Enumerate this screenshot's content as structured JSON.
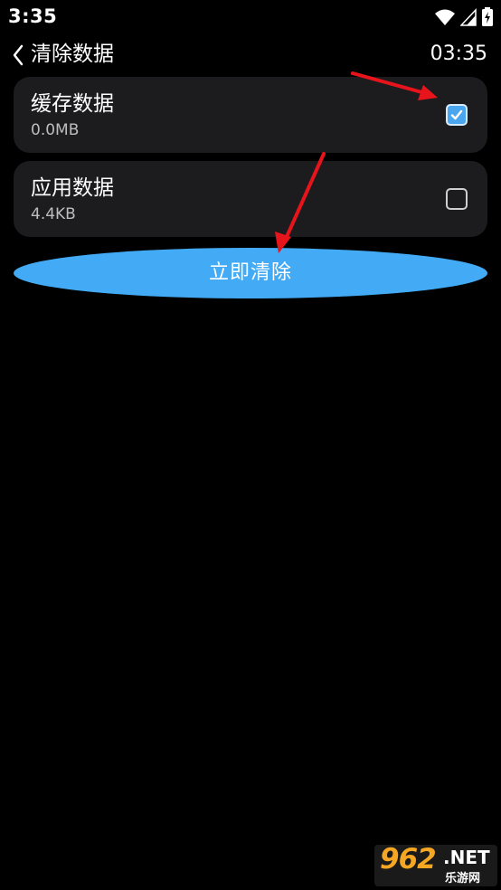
{
  "status_bar": {
    "time": "3:35",
    "icons": [
      "wifi-icon",
      "cell-signal-icon",
      "battery-charging-icon"
    ]
  },
  "header": {
    "back_icon": "chevron-left-icon",
    "title": "清除数据",
    "clock": "03:35"
  },
  "items": [
    {
      "title": "缓存数据",
      "size": "0.0MB",
      "checked": true
    },
    {
      "title": "应用数据",
      "size": "4.4KB",
      "checked": false
    }
  ],
  "clear_button": {
    "label": "立即清除"
  },
  "annotations": {
    "arrow_color": "#e8141c"
  },
  "colors": {
    "background": "#000000",
    "card": "#1c1c1e",
    "accent": "#43abf5"
  },
  "watermark": {
    "digits": "962",
    "suffix": ".NET",
    "text": "乐游网"
  }
}
